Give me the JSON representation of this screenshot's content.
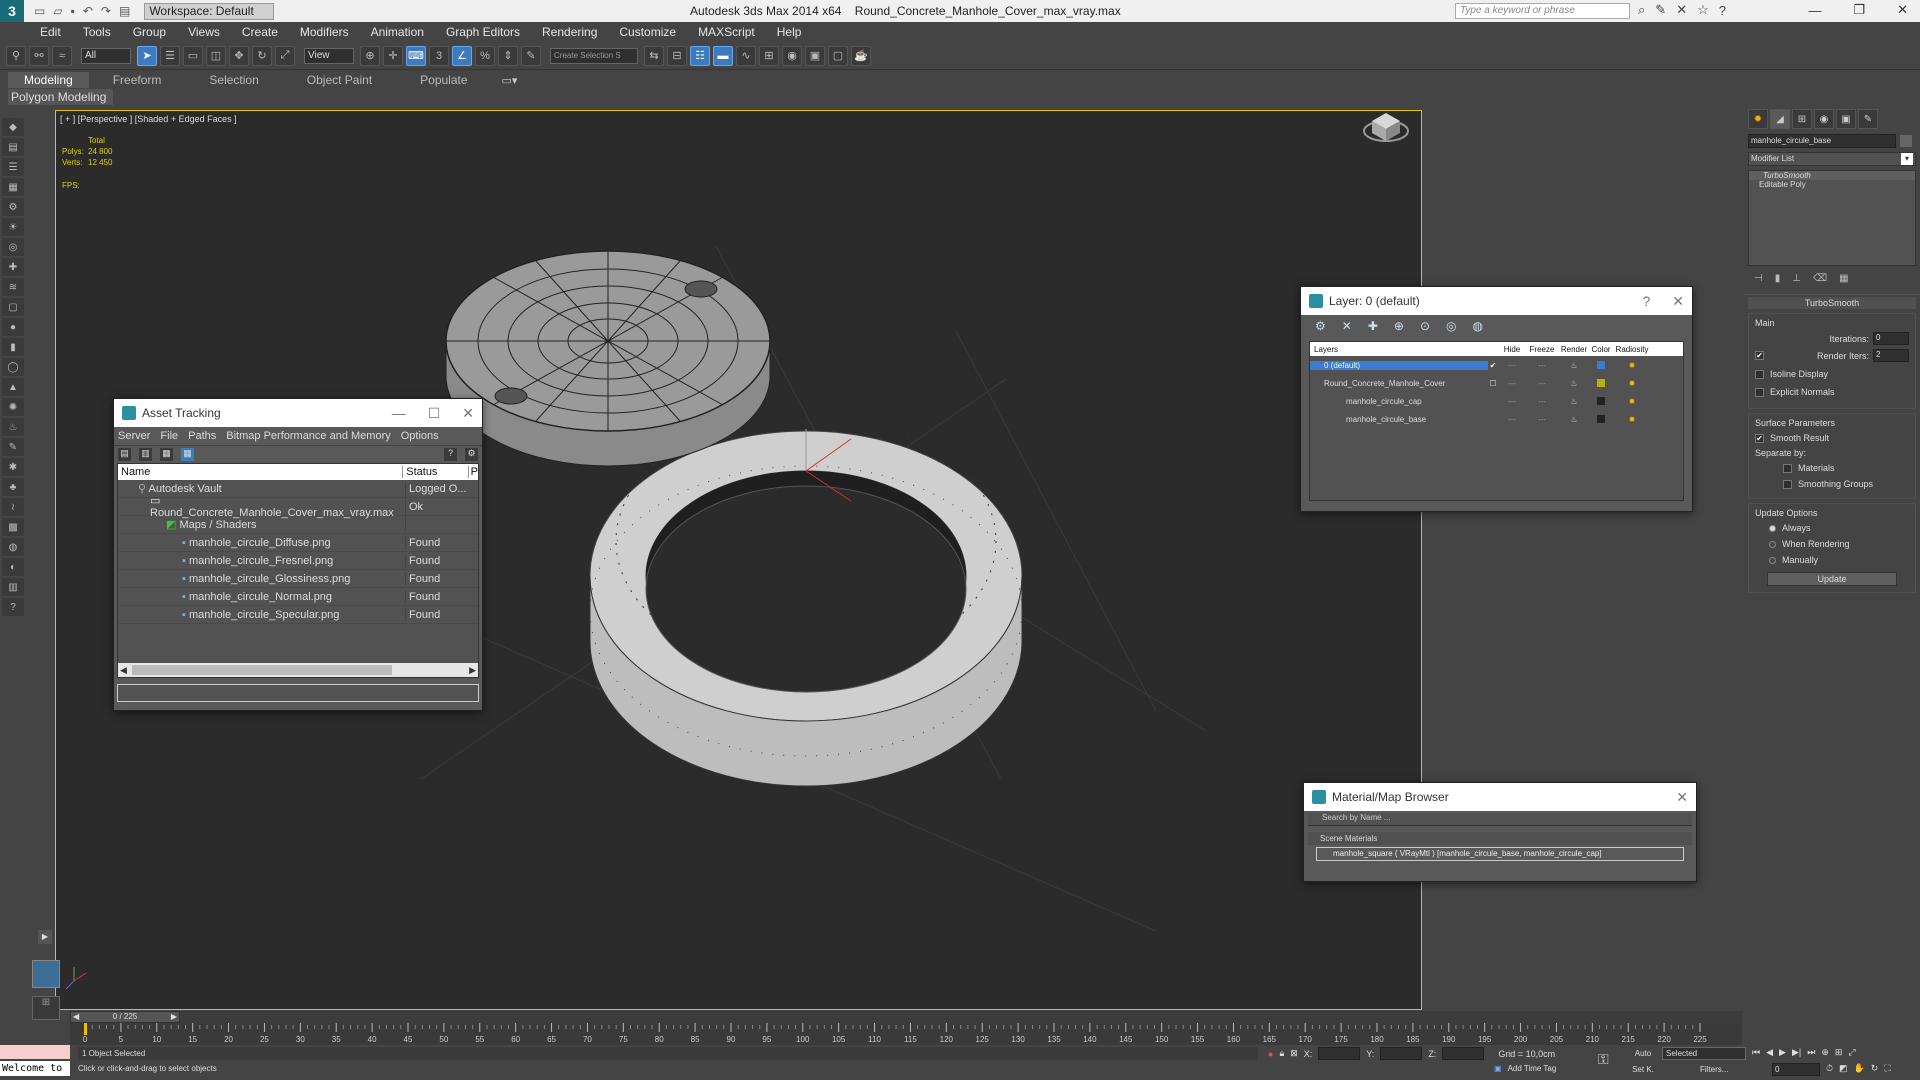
{
  "title_bar": {
    "title": "Autodesk 3ds Max  2014 x64",
    "filename": "Round_Concrete_Manhole_Cover_max_vray.max",
    "search_placeholder": "Type a keyword or phrase",
    "workspace": "Workspace: Default"
  },
  "menu": [
    "Edit",
    "Tools",
    "Group",
    "Views",
    "Create",
    "Modifiers",
    "Animation",
    "Graph Editors",
    "Rendering",
    "Customize",
    "MAXScript",
    "Help"
  ],
  "toolbar": {
    "filter": "All",
    "view": "View",
    "selection_set": "Create Selection S"
  },
  "ribbon": {
    "tabs": [
      "Modeling",
      "Freeform",
      "Selection",
      "Object Paint",
      "Populate"
    ],
    "sub": "Polygon Modeling"
  },
  "viewport": {
    "label": "[ + ] [Perspective ] [Shaded + Edged Faces ]",
    "stats": {
      "total": "Total",
      "polys_label": "Polys:",
      "polys": "24 800",
      "verts_label": "Verts:",
      "verts": "12 450",
      "fps": "FPS:"
    }
  },
  "asset_tracking": {
    "title": "Asset Tracking",
    "menu": [
      "Server",
      "File",
      "Paths",
      "Bitmap Performance and Memory",
      "Options"
    ],
    "headers": {
      "name": "Name",
      "status": "Status",
      "extra": "P"
    },
    "rows": [
      {
        "name": "Autodesk Vault",
        "status": "Logged O..."
      },
      {
        "name": "Round_Concrete_Manhole_Cover_max_vray.max",
        "status": "Ok"
      },
      {
        "name": "Maps / Shaders",
        "status": ""
      },
      {
        "name": "manhole_circule_Diffuse.png",
        "status": "Found"
      },
      {
        "name": "manhole_circule_Fresnel.png",
        "status": "Found"
      },
      {
        "name": "manhole_circule_Glossiness.png",
        "status": "Found"
      },
      {
        "name": "manhole_circule_Normal.png",
        "status": "Found"
      },
      {
        "name": "manhole_circule_Specular.png",
        "status": "Found"
      }
    ]
  },
  "layer_dialog": {
    "title": "Layer: 0 (default)",
    "help": "?",
    "headers": {
      "layers": "Layers",
      "hide": "Hide",
      "freeze": "Freeze",
      "render": "Render",
      "color": "Color",
      "radiosity": "Radiosity"
    },
    "rows": [
      {
        "name": "0 (default)",
        "color": "#3d7bd0"
      },
      {
        "name": "Round_Concrete_Manhole_Cover",
        "color": "#b8b000"
      },
      {
        "name": "manhole_circule_cap",
        "color": "#222222"
      },
      {
        "name": "manhole_circule_base",
        "color": "#222222"
      }
    ]
  },
  "material_browser": {
    "title": "Material/Map Browser",
    "search_placeholder": "Search by Name ...",
    "section": "Scene Materials",
    "item": "manhole_square ( VRayMtl ) [manhole_circule_base, manhole_circule_cap]"
  },
  "command_panel": {
    "object_name": "manhole_circule_base",
    "modifier_list": "Modifier List",
    "stack": [
      "TurboSmooth",
      "Editable Poly"
    ],
    "rollout": "TurboSmooth",
    "main": "Main",
    "iterations_label": "Iterations:",
    "iterations": "0",
    "render_iters_label": "Render Iters:",
    "render_iters": "2",
    "isoline": "Isoline Display",
    "explicit": "Explicit Normals",
    "surface": "Surface Parameters",
    "smooth_result": "Smooth Result",
    "separate_by": "Separate by:",
    "materials": "Materials",
    "smoothing_groups": "Smoothing Groups",
    "update_options": "Update Options",
    "always": "Always",
    "when_rendering": "When Rendering",
    "manually": "Manually",
    "update_btn": "Update"
  },
  "timeline": {
    "frame": "0 / 225",
    "ticks": [
      "0",
      "5",
      "10",
      "15",
      "20",
      "25",
      "30",
      "35",
      "40",
      "45",
      "50",
      "55",
      "60",
      "65",
      "70",
      "75",
      "80",
      "85",
      "90",
      "95",
      "100",
      "105",
      "110",
      "115",
      "120",
      "125",
      "130",
      "135",
      "140",
      "145",
      "150",
      "155",
      "160",
      "165",
      "170",
      "175",
      "180",
      "185",
      "190",
      "195",
      "200",
      "205",
      "210",
      "215",
      "220",
      "225"
    ]
  },
  "status": {
    "welcome": "Welcome to",
    "selected": "1 Object Selected",
    "prompt": "Click or click-and-drag to select objects",
    "x": "X:",
    "y": "Y:",
    "z": "Z:",
    "grid": "Grid = 10,0cm",
    "add_time_tag": "Add Time Tag",
    "auto": "Auto",
    "set_k": "Set K.",
    "selected_dd": "Selected",
    "filters": "Filters...",
    "frame_field": "0"
  }
}
